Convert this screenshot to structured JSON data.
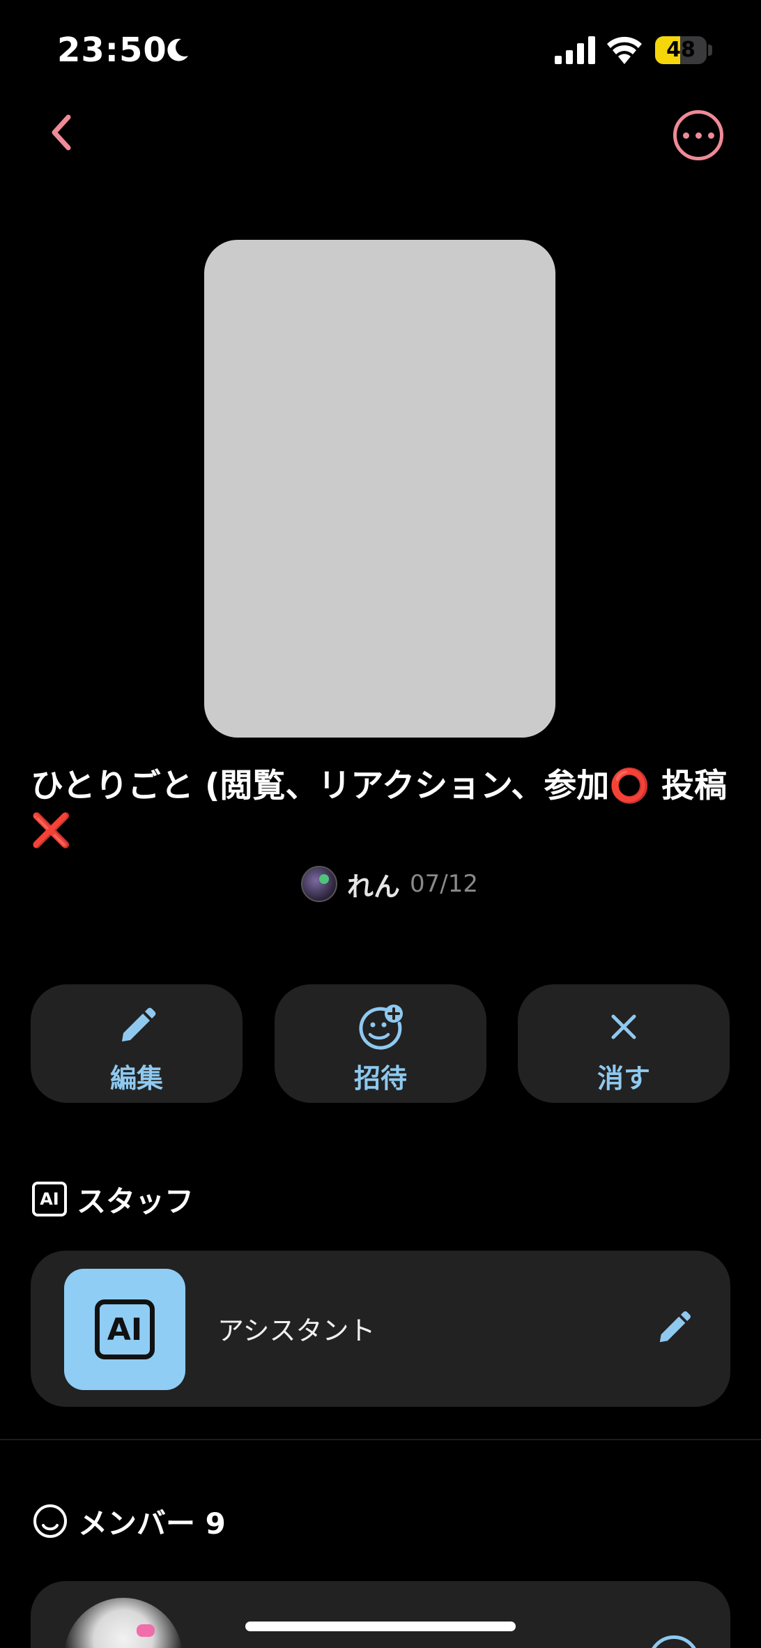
{
  "status_bar": {
    "time": "23:50",
    "battery_level": "48",
    "battery_fraction": 0.48,
    "icons": [
      "moon-icon",
      "signal-icon",
      "wifi-icon",
      "battery-icon"
    ]
  },
  "nav": {
    "back_icon": "chevron-left-icon",
    "more_icon": "ellipsis-circle-icon",
    "accent_color": "#ef8a97"
  },
  "post": {
    "title_prefix": "ひとりごと (閲覧、リアクション、参加",
    "title_mark_allowed": "⭕",
    "title_middle": " 投稿",
    "title_mark_denied": "❌",
    "author_name": "れん",
    "date": "07/12"
  },
  "actions": [
    {
      "label": "編集",
      "icon": "pencil-icon"
    },
    {
      "label": "招待",
      "icon": "add-person-icon"
    },
    {
      "label": "消す",
      "icon": "close-icon"
    }
  ],
  "staff_section": {
    "title": "スタッフ",
    "icon": "ai-icon",
    "items": [
      {
        "name": "アシスタント",
        "avatar_text": "AI",
        "action_icon": "pencil-icon"
      }
    ]
  },
  "members_section": {
    "title": "メンバー 9",
    "icon": "smile-icon"
  },
  "colors": {
    "background": "#000000",
    "card": "#222222",
    "action_text": "#8fc9f0",
    "mark_red": "#e11d1d",
    "battery_yellow": "#f5d60a"
  }
}
